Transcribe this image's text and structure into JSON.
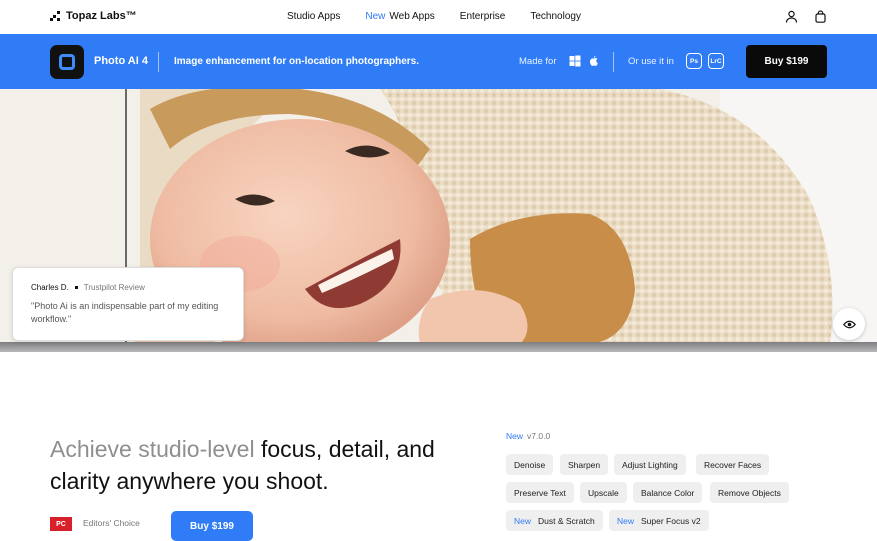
{
  "nav": {
    "logo_text": "Topaz Labs™",
    "links": [
      {
        "label": "Studio Apps",
        "new": ""
      },
      {
        "label": "Web Apps",
        "new": "New"
      },
      {
        "label": "Enterprise",
        "new": ""
      },
      {
        "label": "Technology",
        "new": ""
      }
    ],
    "icons": [
      "user-icon",
      "bag-icon"
    ]
  },
  "product_bar": {
    "app_name": "Photo AI 4",
    "tagline": "Image enhancement for on-location photographers.",
    "made_for_label": "Made for",
    "os_icons": [
      "windows-icon",
      "apple-icon"
    ],
    "or_use_label": "Or use it in",
    "plugins": [
      "Ps",
      "LrC"
    ],
    "buy_label": "Buy  $199",
    "color": "#2f7cf6"
  },
  "hero": {
    "review": {
      "author": "Charles D.",
      "source": "Trustpilot Review",
      "quote": "\"Photo Ai is an indispensable part of my editing workflow.\""
    }
  },
  "intro": {
    "headline_muted": "Achieve studio-level",
    "headline_strong": " focus, detail, and clarity anywhere you shoot.",
    "version_new": "New",
    "version": "v7.0.0",
    "features": [
      {
        "label": "Denoise",
        "new": ""
      },
      {
        "label": "Sharpen",
        "new": ""
      },
      {
        "label": "Adjust Lighting",
        "new": ""
      },
      {
        "label": "Recover Faces",
        "new": ""
      },
      {
        "label": "Preserve Text",
        "new": ""
      },
      {
        "label": "Upscale",
        "new": ""
      },
      {
        "label": "Balance Color",
        "new": ""
      },
      {
        "label": "Remove Objects",
        "new": ""
      },
      {
        "label": "Dust & Scratch",
        "new": "New"
      },
      {
        "label": "Super Focus v2",
        "new": "New"
      }
    ],
    "badge_text": "PC",
    "editors_choice": "Editors' Choice",
    "buy_label": "Buy  $199"
  }
}
